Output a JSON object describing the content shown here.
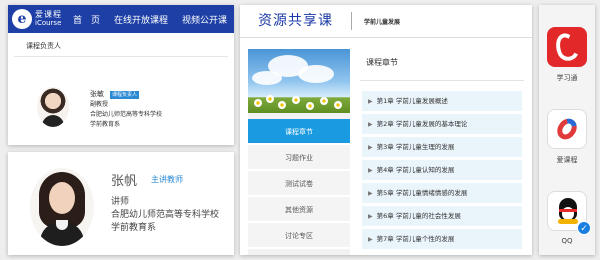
{
  "icourse": {
    "logo_cn": "爱课程",
    "logo_en": "iCourse",
    "logo_mark": "e",
    "nav": [
      "首　页",
      "在线开放课程",
      "视频公开课"
    ],
    "section_label": "课程负责人",
    "lead": {
      "name": "张敏",
      "badge": "课程负责人",
      "title": "副教授",
      "school": "合肥幼儿师范高等专科学校",
      "dept": "学前教育系"
    }
  },
  "teacher_card": {
    "name": "张帆",
    "role": "主讲教师",
    "title": "讲师",
    "school": "合肥幼儿师范高等专科学校",
    "dept": "学前教育系"
  },
  "resource": {
    "title": "资源共享课",
    "course_name": "学前儿童发展",
    "menu": [
      {
        "label": "课程章节",
        "active": true
      },
      {
        "label": "习题作业",
        "active": false
      },
      {
        "label": "测试试卷",
        "active": false
      },
      {
        "label": "其他资源",
        "active": false
      },
      {
        "label": "讨论专区",
        "active": false
      }
    ],
    "chapters_title": "课程章节",
    "chapters": [
      "第1章 学前儿童发展概述",
      "第2章 学前儿童发展的基本理论",
      "第3章 学前儿童生理的发展",
      "第4章 学前儿童认知的发展",
      "第5章 学前儿童情绪情感的发展",
      "第6章 学前儿童的社会性发展",
      "第7章 学前儿童个性的发展"
    ]
  },
  "apps": [
    {
      "label": "学习通",
      "icon": "xuexitong-icon"
    },
    {
      "label": "爱课程",
      "icon": "icourse-app-icon"
    },
    {
      "label": "QQ",
      "icon": "qq-icon"
    }
  ],
  "colors": {
    "header_blue": "#1d3fa6",
    "accent_blue": "#1a9ae0",
    "chapter_bg": "#eaf4fb"
  }
}
